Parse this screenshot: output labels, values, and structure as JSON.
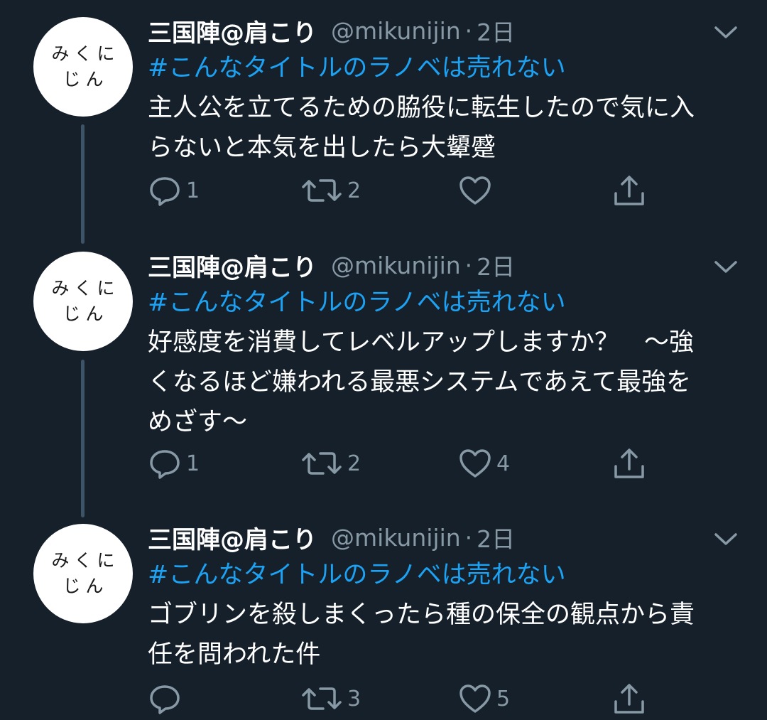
{
  "author": {
    "name": "三国陣@肩こり",
    "handle": "@mikunijin",
    "avatar_text": [
      "みくに",
      "じん"
    ]
  },
  "tweets": [
    {
      "time": "2日",
      "hashtag": "#こんなタイトルのラノベは売れない",
      "text": "主人公を立てるための脇役に転生したので気に入らないと本気を出したら大顰蹙",
      "replies": "1",
      "retweets": "2",
      "likes": ""
    },
    {
      "time": "2日",
      "hashtag": "#こんなタイトルのラノベは売れない",
      "text": "好感度を消費してレベルアップしますか？　～強くなるほど嫌われる最悪システムであえて最強をめざす～",
      "replies": "1",
      "retweets": "2",
      "likes": "4"
    },
    {
      "time": "2日",
      "hashtag": "#こんなタイトルのラノベは売れない",
      "text": "ゴブリンを殺しまくったら種の保全の観点から責任を問われた件",
      "replies": "",
      "retweets": "3",
      "likes": "5"
    }
  ],
  "separator": "·",
  "icons": {
    "reply": "reply-icon",
    "retweet": "retweet-icon",
    "like": "heart-icon",
    "share": "share-icon",
    "menu": "chevron-down-icon"
  },
  "colors": {
    "background": "#15202b",
    "hashtag": "#1da1f2",
    "secondary_text": "#8899a6",
    "thread_line": "#3d5466"
  }
}
